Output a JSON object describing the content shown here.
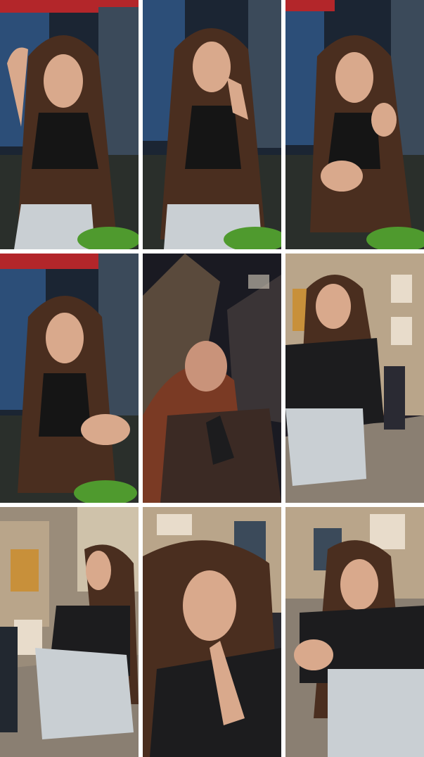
{
  "collage": {
    "layout": "3x3 grid",
    "frames": [
      {
        "scene": "cafe-interior",
        "pose": "hand-in-hair"
      },
      {
        "scene": "cafe-interior",
        "pose": "finger-raised"
      },
      {
        "scene": "cafe-interior",
        "pose": "gesturing"
      },
      {
        "scene": "cafe-interior",
        "pose": "hand-gesture-low"
      },
      {
        "scene": "night-street-blurred",
        "pose": "looking-up"
      },
      {
        "scene": "night-street",
        "pose": "crouching"
      },
      {
        "scene": "night-street",
        "pose": "crouching-profile"
      },
      {
        "scene": "night-street",
        "pose": "talking-finger-raised"
      },
      {
        "scene": "night-street",
        "pose": "crouching-front"
      }
    ]
  },
  "colors": {
    "hair": "#4a2e1f",
    "skin": "#d9a98c",
    "black_top": "#151515",
    "leather_jacket": "#1c1c1e",
    "jeans": "#c9cfd3",
    "salad": "#4f9a2e",
    "cafe_window": "#2c4e78",
    "awning_red": "#b3262a",
    "night_sky": "#1a1a22",
    "building_stone": "#b9a58a",
    "street_paving": "#8a7f72"
  }
}
